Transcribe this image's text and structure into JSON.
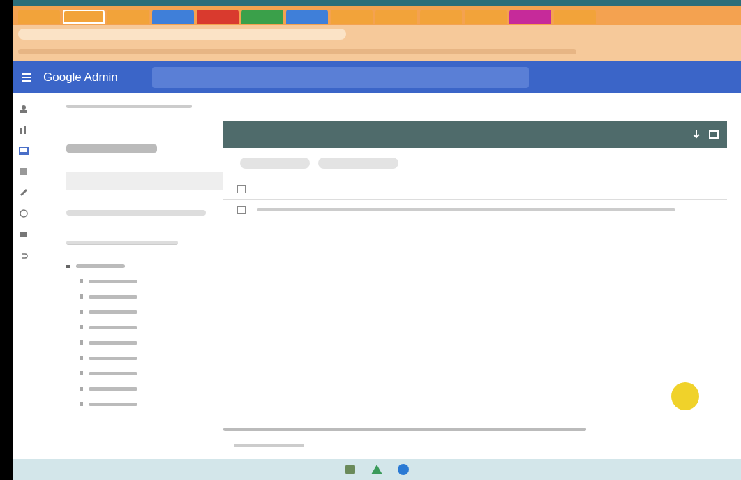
{
  "browser": {
    "tabs": [
      {
        "color": "#f2a33a",
        "selected": false
      },
      {
        "color": "#f2a33a",
        "selected": true
      },
      {
        "color": "#f2a33a",
        "selected": false
      },
      {
        "color": "#3f7fd9",
        "selected": false
      },
      {
        "color": "#d93a2e",
        "selected": false
      },
      {
        "color": "#3aa04a",
        "selected": false
      },
      {
        "color": "#3f7fd9",
        "selected": false
      },
      {
        "color": "#f2a33a",
        "selected": false
      },
      {
        "color": "#f2a33a",
        "selected": false
      },
      {
        "color": "#f2a33a",
        "selected": false
      },
      {
        "color": "#f2a33a",
        "selected": false
      },
      {
        "color": "#c62a9a",
        "selected": false
      },
      {
        "color": "#f2a33a",
        "selected": false
      }
    ]
  },
  "header": {
    "title": "Google Admin"
  },
  "tree": {
    "expanded": true,
    "children": [
      {
        "expanded": false
      },
      {
        "expanded": false
      },
      {
        "expanded": false
      },
      {
        "expanded": false
      },
      {
        "expanded": false
      },
      {
        "expanded": false
      },
      {
        "expanded": false
      },
      {
        "expanded": false
      },
      {
        "expanded": false
      }
    ]
  },
  "table": {
    "rows": [
      {
        "selected": false
      }
    ]
  }
}
